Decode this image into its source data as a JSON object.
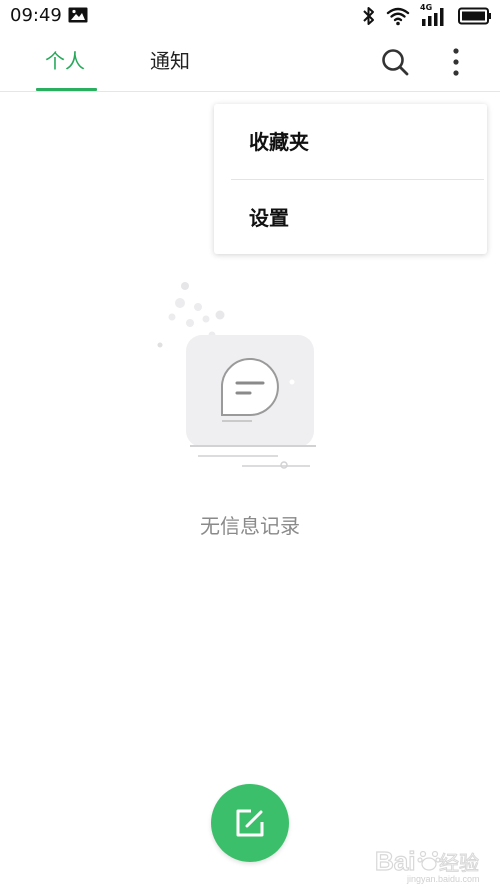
{
  "status_bar": {
    "time": "09:49",
    "network_label": "4G",
    "icons": [
      "image-icon",
      "bluetooth-icon",
      "wifi-icon",
      "signal-icon",
      "battery-icon"
    ]
  },
  "header": {
    "tabs": [
      {
        "label": "个人",
        "active": true
      },
      {
        "label": "通知",
        "active": false
      }
    ],
    "actions": [
      "search-icon",
      "more-vertical-icon"
    ]
  },
  "menu": {
    "items": [
      {
        "label": "收藏夹"
      },
      {
        "label": "设置"
      }
    ]
  },
  "empty_state": {
    "text": "无信息记录",
    "illustration": "chat-bubble-icon"
  },
  "fab": {
    "icon": "edit-icon"
  },
  "colors": {
    "accent": "#2aae5f",
    "fab": "#3cbf6a",
    "muted_text": "#8a8a8a"
  }
}
